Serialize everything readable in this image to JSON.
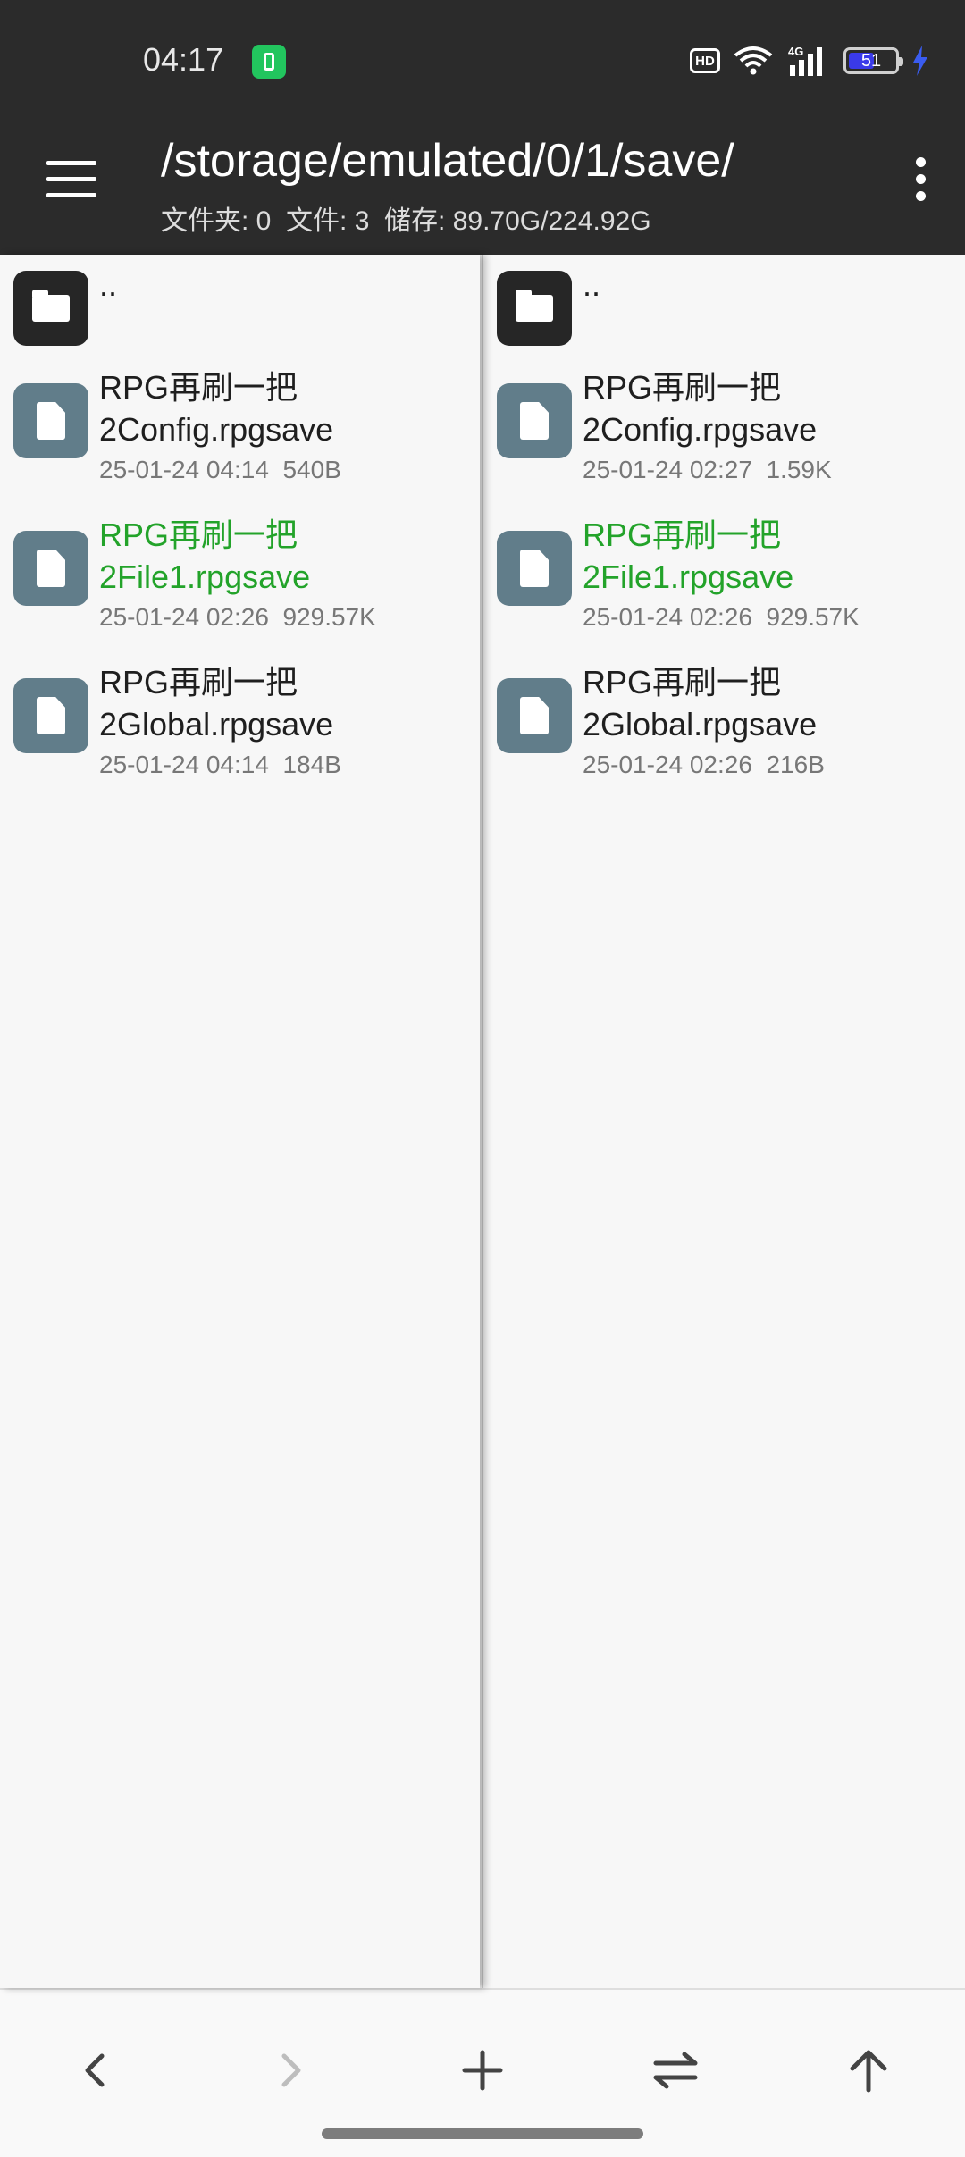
{
  "status_bar": {
    "time": "04:17",
    "network": "4G",
    "hd_label": "HD",
    "battery": "51"
  },
  "app_bar": {
    "path": "/storage/emulated/0/1/save/",
    "summary": "文件夹: 0  文件: 3  储存: 89.70G/224.92G",
    "menu_icon": "hamburger-menu-icon",
    "overflow_icon": "more-vert-icon"
  },
  "left_pane": {
    "up_label": "..",
    "files": [
      {
        "name": "RPG再刷一把\n2Config.rpgsave",
        "line1": "RPG再刷一把",
        "line2": "2Config.rpgsave",
        "meta": "25-01-24 04:14  540B"
      },
      {
        "name": "RPG再刷一把\n2File1.rpgsave",
        "line1": "RPG再刷一把",
        "line2": "2File1.rpgsave",
        "meta": "25-01-24 02:26  929.57K"
      },
      {
        "name": "RPG再刷一把\n2Global.rpgsave",
        "line1": "RPG再刷一把",
        "line2": "2Global.rpgsave",
        "meta": "25-01-24 04:14  184B"
      }
    ]
  },
  "right_pane": {
    "up_label": "..",
    "files": [
      {
        "line1": "RPG再刷一把",
        "line2": "2Config.rpgsave",
        "meta": "25-01-24 02:27  1.59K"
      },
      {
        "line1": "RPG再刷一把",
        "line2": "2File1.rpgsave",
        "meta": "25-01-24 02:26  929.57K"
      },
      {
        "line1": "RPG再刷一把",
        "line2": "2Global.rpgsave",
        "meta": "25-01-24 02:26  216B"
      }
    ]
  },
  "colors": {
    "highlight": "#23a32a",
    "file_icon_bg": "#617d8a",
    "folder_icon_bg": "#262626",
    "appbar_bg": "#2b2b2b"
  },
  "bottom_bar": {
    "buttons": [
      "back-arrow-icon",
      "forward-arrow-icon",
      "add-icon",
      "swap-panes-icon",
      "up-arrow-icon"
    ]
  }
}
